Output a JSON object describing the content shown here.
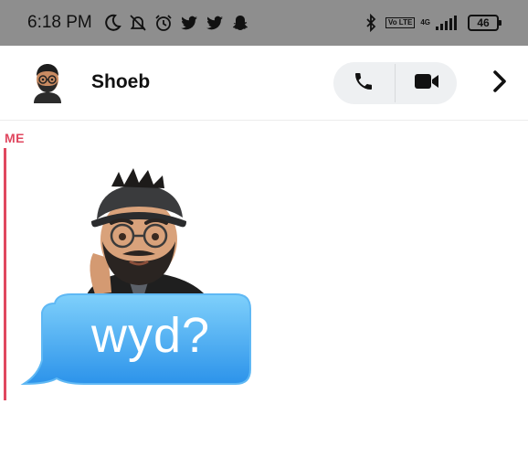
{
  "status_bar": {
    "time": "6:18 PM",
    "network_label": "4G",
    "battery": "46",
    "volte": "Vo LTE",
    "icons": [
      "moon-icon",
      "muted-bell-icon",
      "alarm-icon",
      "twitter-icon",
      "twitter-icon",
      "snapchat-icon",
      "bluetooth-icon",
      "volte-icon",
      "signal-icon",
      "battery-icon"
    ]
  },
  "chat_header": {
    "contact_name": "Shoeb",
    "actions": [
      "phone-icon",
      "video-camera-icon",
      "chevron-right-icon"
    ]
  },
  "message": {
    "sender_label": "ME",
    "sticker_text": "wyd?",
    "accent_color": "#e0475f"
  }
}
